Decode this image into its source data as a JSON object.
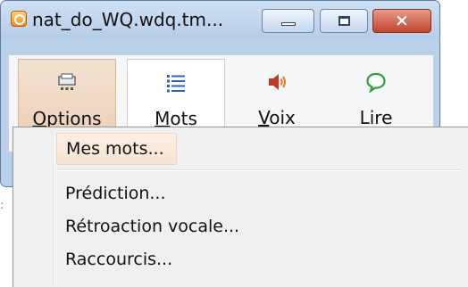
{
  "window": {
    "title": "nat_do_WQ.wdq.tm...",
    "close_glyph": "×"
  },
  "toolbar": {
    "items": [
      {
        "label": "Options",
        "mnemonic": "O",
        "icon": "printer-icon",
        "state": "pressed"
      },
      {
        "label": "Mots",
        "mnemonic": "M",
        "icon": "list-icon",
        "state": "raised"
      },
      {
        "label": "Voix",
        "mnemonic": "V",
        "icon": "speaker-icon",
        "state": "normal"
      },
      {
        "label": "Lire",
        "mnemonic": "L",
        "icon": "speech-bubble-icon",
        "state": "normal"
      }
    ]
  },
  "menu": {
    "items": [
      {
        "label": "Mes mots...",
        "highlighted": true
      },
      {
        "label": "Prédiction..."
      },
      {
        "label": "Rétroaction vocale..."
      },
      {
        "label": "Raccourcis..."
      }
    ]
  },
  "colors": {
    "window_frame": "#b9d1ea",
    "close_button": "#c2442c",
    "pressed_tool": "#eccfb6",
    "menu_background": "#f0f0f0"
  }
}
